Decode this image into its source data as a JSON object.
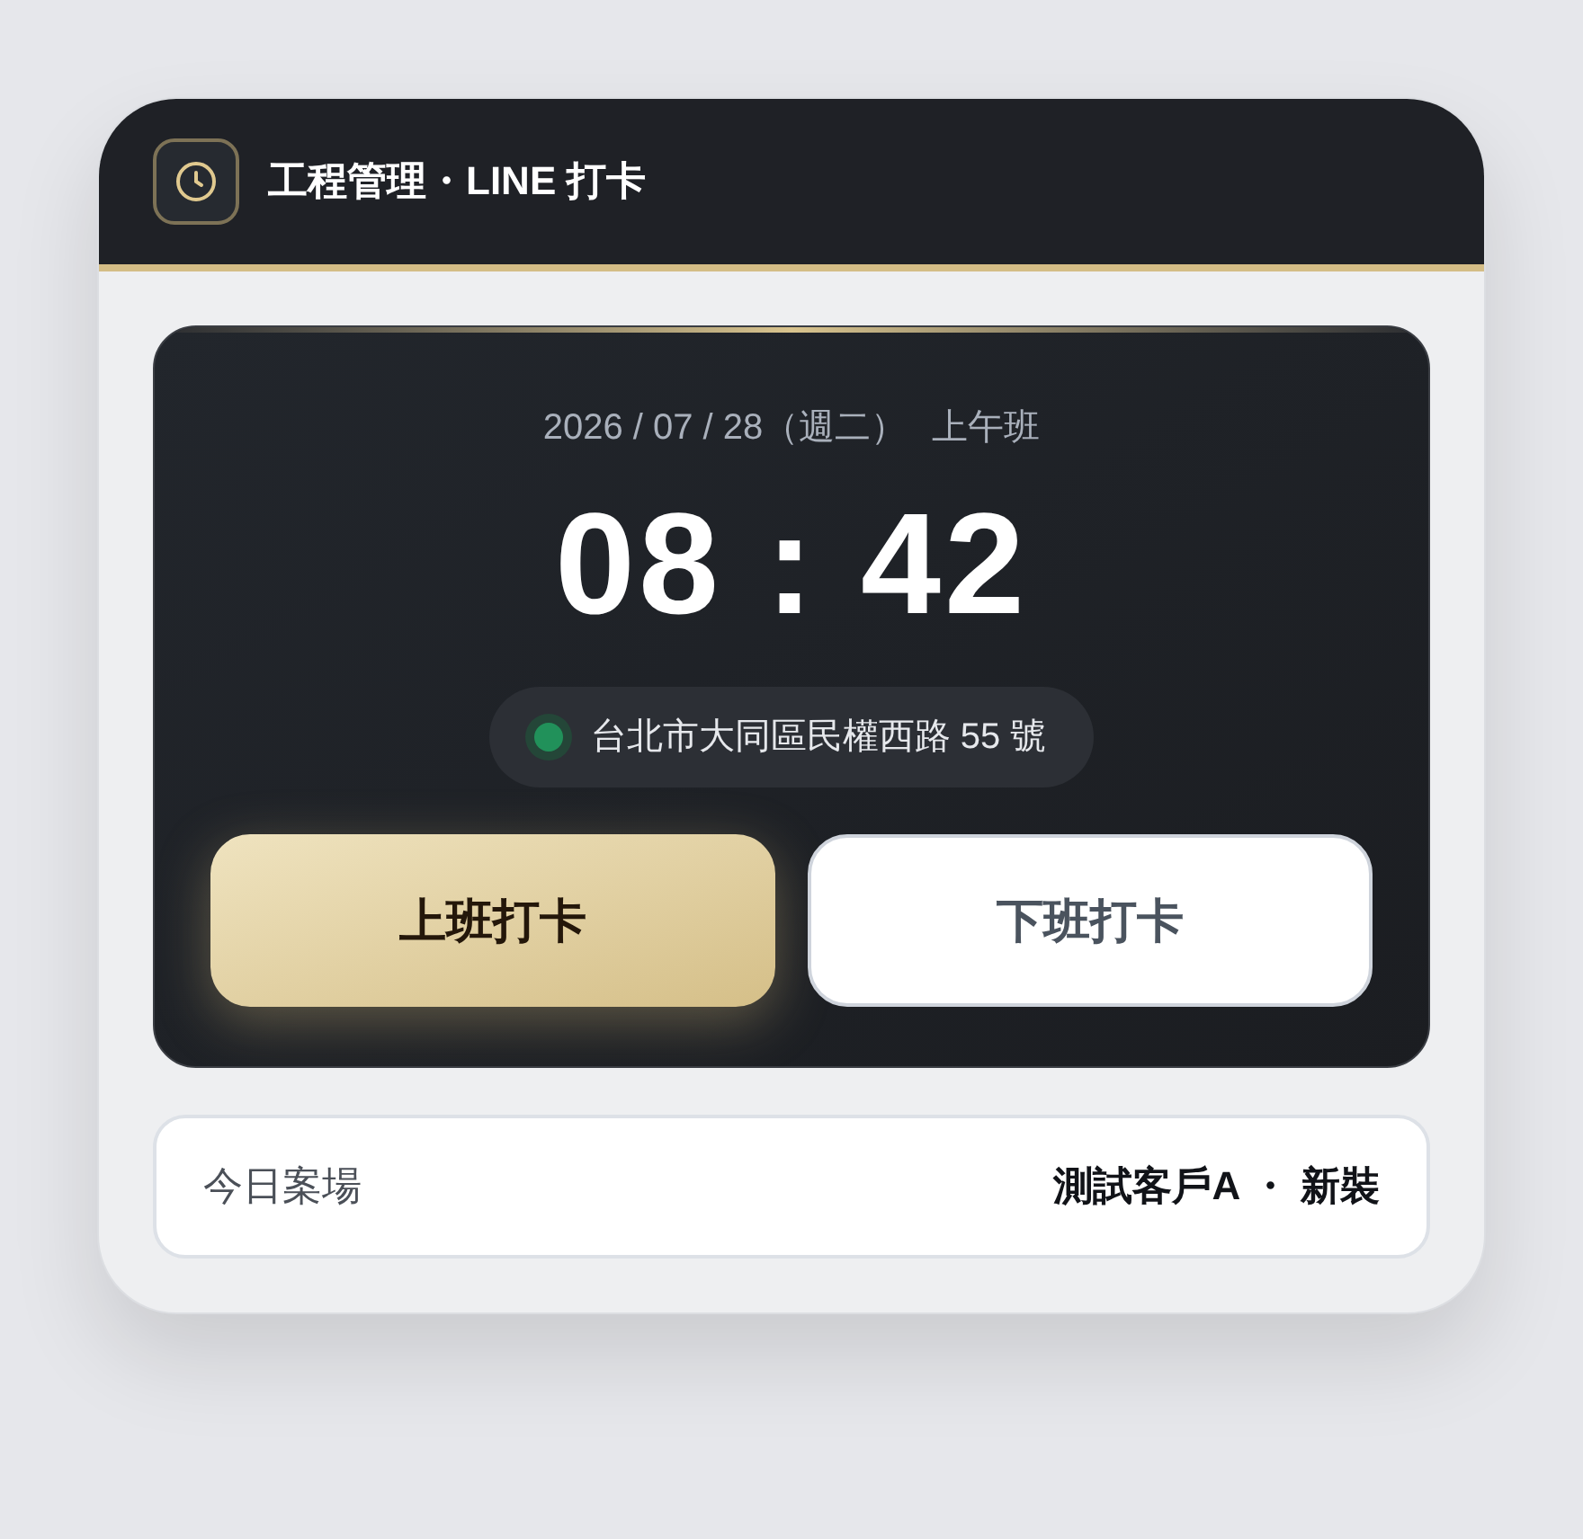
{
  "header": {
    "title": "工程管理・LINE 打卡"
  },
  "clock": {
    "date": "2026 / 07 / 28（週二）",
    "shift": "上午班",
    "time": "08 : 42",
    "location": "台北市大同區民權西路 55 號"
  },
  "buttons": [
    {
      "label": "上班打卡",
      "kind": "primary"
    },
    {
      "label": "下班打卡",
      "kind": "secondary"
    }
  ],
  "site": {
    "label": "今日案場",
    "value": "測試客戶A ・ 新裝"
  }
}
